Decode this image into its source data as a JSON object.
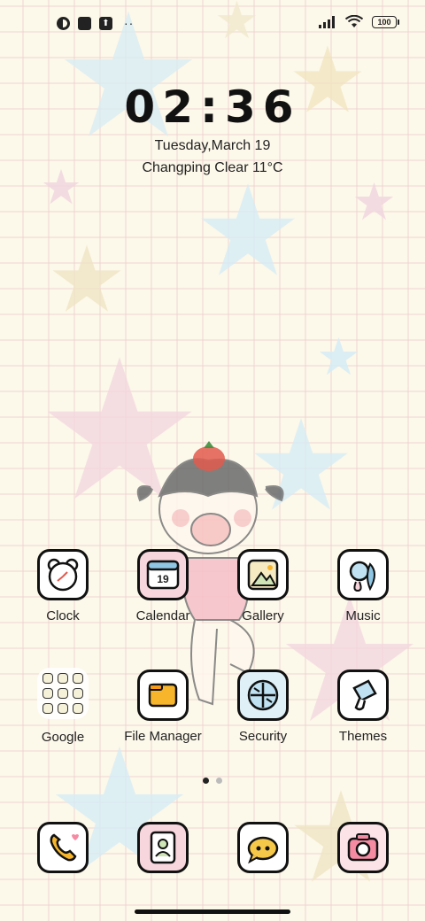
{
  "status_bar": {
    "icons_left": [
      "circle-app-icon",
      "square-app-icon",
      "upload-icon",
      "more-dots-icon"
    ],
    "dots": "··",
    "battery": "100"
  },
  "clock": {
    "time": "02:36",
    "date": "Tuesday,March 19",
    "weather": "Changping Clear 11°C"
  },
  "apps_row1": [
    {
      "label": "Clock",
      "icon": "clock-icon"
    },
    {
      "label": "Calendar",
      "icon": "calendar-icon",
      "badge": "19"
    },
    {
      "label": "Gallery",
      "icon": "gallery-icon"
    },
    {
      "label": "Music",
      "icon": "music-icon"
    }
  ],
  "apps_row2": [
    {
      "label": "Google",
      "icon": "folder-icon"
    },
    {
      "label": "File Manager",
      "icon": "folder-file-icon"
    },
    {
      "label": "Security",
      "icon": "security-icon"
    },
    {
      "label": "Themes",
      "icon": "themes-icon"
    }
  ],
  "dock": [
    {
      "icon": "phone-icon"
    },
    {
      "icon": "contacts-icon"
    },
    {
      "icon": "messages-icon"
    },
    {
      "icon": "camera-icon"
    }
  ],
  "page_indicator": {
    "pages": 2,
    "active": 1
  },
  "colors": {
    "background": "#fcf8ea",
    "grid": "#ecc8c8",
    "accent_yellow": "#f7b52c",
    "accent_pink": "#f6c1cf",
    "accent_blue": "#bfe1f1"
  }
}
